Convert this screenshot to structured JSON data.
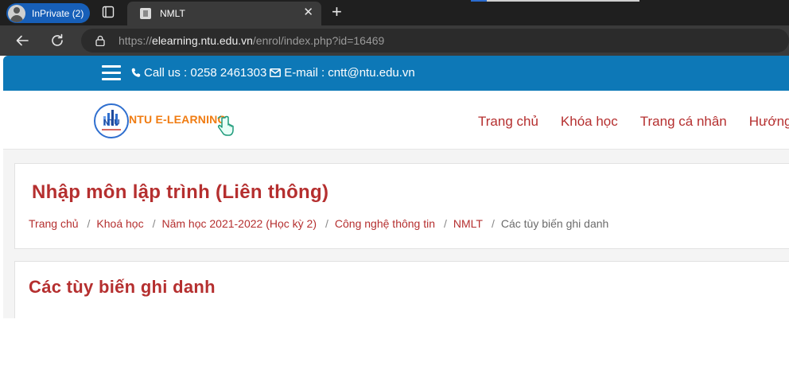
{
  "browser": {
    "profile_label": "InPrivate (2)",
    "tab_title": "NMLT",
    "tab_close": "✕",
    "new_tab": "+",
    "url_scheme": "https://",
    "url_host": "elearning.ntu.edu.vn",
    "url_path": "/enrol/index.php?id=16469"
  },
  "topbar": {
    "phone_text": "Call us : 0258 2461303",
    "email_text": "E-mail : cntt@ntu.edu.vn"
  },
  "header": {
    "logo_seal_text": "NTU",
    "logo_brand": "NTU E-LEARNING",
    "nav": [
      "Trang chủ",
      "Khóa học",
      "Trang cá nhân",
      "Hướng dẫn"
    ]
  },
  "main": {
    "course_title": "Nhập môn lập trình (Liên thông)",
    "breadcrumb": [
      "Trang chủ",
      "Khoá học",
      "Năm học 2021-2022 (Học kỳ 2)",
      "Công nghệ thông tin",
      "NMLT"
    ],
    "breadcrumb_current": "Các tùy biến ghi danh",
    "breadcrumb_separator": "/",
    "section_title": "Các tùy biến ghi danh"
  },
  "colors": {
    "topbar_blue": "#0d78b7",
    "accent_red": "#b52f2f",
    "logo_orange": "#f07c12"
  }
}
